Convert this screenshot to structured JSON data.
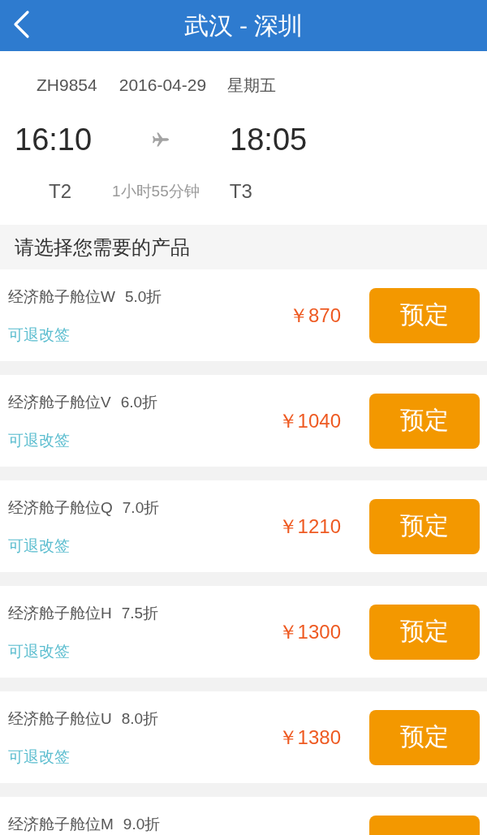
{
  "header": {
    "title": "武汉 - 深圳"
  },
  "flight": {
    "flight_no": "ZH9854",
    "date": "2016-04-29",
    "weekday": "星期五",
    "depart_time": "16:10",
    "arrive_time": "18:05",
    "depart_terminal": "T2",
    "duration": "1小时55分钟",
    "arrive_terminal": "T3"
  },
  "section_title": "请选择您需要的产品",
  "products": [
    {
      "cabin": "经济舱子舱位W",
      "discount": "5.0折",
      "policy": "可退改签",
      "price": "￥870",
      "button": "预定"
    },
    {
      "cabin": "经济舱子舱位V",
      "discount": "6.0折",
      "policy": "可退改签",
      "price": "￥1040",
      "button": "预定"
    },
    {
      "cabin": "经济舱子舱位Q",
      "discount": "7.0折",
      "policy": "可退改签",
      "price": "￥1210",
      "button": "预定"
    },
    {
      "cabin": "经济舱子舱位H",
      "discount": "7.5折",
      "policy": "可退改签",
      "price": "￥1300",
      "button": "预定"
    },
    {
      "cabin": "经济舱子舱位U",
      "discount": "8.0折",
      "policy": "可退改签",
      "price": "￥1380",
      "button": "预定"
    },
    {
      "cabin": "经济舱子舱位M",
      "discount": "9.0折"
    }
  ]
}
